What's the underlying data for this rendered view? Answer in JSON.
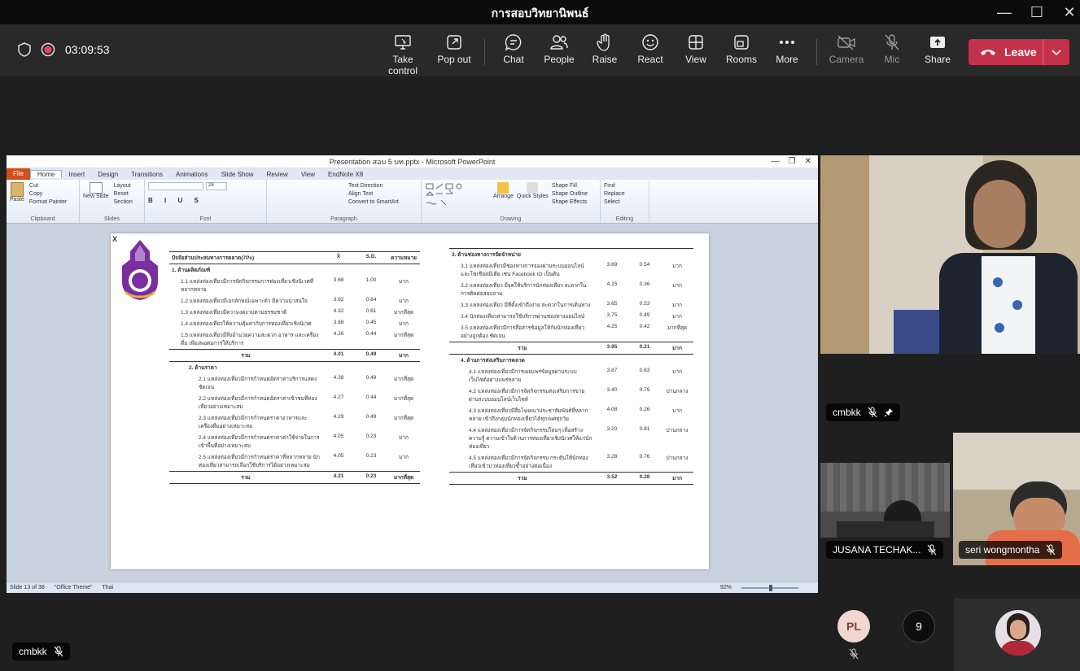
{
  "window": {
    "title": "การสอบวิทยานิพนธ์",
    "controls": [
      "minimize",
      "maximize",
      "close"
    ]
  },
  "toolbar": {
    "timer": "03:09:53",
    "buttons": [
      {
        "label": "Take control",
        "icon": "take-control-icon"
      },
      {
        "label": "Pop out",
        "icon": "pop-out-icon"
      },
      {
        "label": "Chat",
        "icon": "chat-icon"
      },
      {
        "label": "People",
        "icon": "people-icon"
      },
      {
        "label": "Raise",
        "icon": "raise-hand-icon"
      },
      {
        "label": "React",
        "icon": "react-icon"
      },
      {
        "label": "View",
        "icon": "view-icon"
      },
      {
        "label": "Rooms",
        "icon": "rooms-icon"
      },
      {
        "label": "More",
        "icon": "more-icon"
      },
      {
        "label": "Camera",
        "icon": "camera-off-icon"
      },
      {
        "label": "Mic",
        "icon": "mic-off-icon"
      },
      {
        "label": "Share",
        "icon": "share-icon"
      }
    ],
    "leave_label": "Leave",
    "leave_color": "#c4314b"
  },
  "powerpoint": {
    "title": "Presentation สอบ 5 บท.pptx - Microsoft PowerPoint",
    "tabs": [
      "File",
      "Home",
      "Insert",
      "Design",
      "Transitions",
      "Animations",
      "Slide Show",
      "Review",
      "View",
      "EndNote X8"
    ],
    "ribbon": {
      "clipboard": {
        "name": "Clipboard",
        "paste": "Paste",
        "cut": "Cut",
        "copy": "Copy",
        "format_painter": "Format Painter"
      },
      "slides": {
        "name": "Slides",
        "new_slide": "New Slide",
        "layout": "Layout",
        "reset": "Reset",
        "section": "Section"
      },
      "font": {
        "name": "Font",
        "size": "28"
      },
      "paragraph": {
        "name": "Paragraph",
        "text_direction": "Text Direction",
        "align_text": "Align Text",
        "smartart": "Convert to SmartArt"
      },
      "drawing": {
        "name": "Drawing",
        "arrange": "Arrange",
        "quick_styles": "Quick Styles",
        "shape_fill": "Shape Fill",
        "shape_outline": "Shape Outline",
        "shape_effects": "Shape Effects"
      },
      "editing": {
        "name": "Editing",
        "find": "Find",
        "replace": "Replace",
        "select": "Select"
      }
    },
    "status": {
      "slide": "Slide 13 of 38",
      "theme": "\"Office Theme\"",
      "lang": "Thai",
      "zoom": "92%"
    }
  },
  "slide": {
    "close_mark": "X",
    "left_header": {
      "title": "ปัจจัยส่วนประสมทางการตลาด(7Ps)",
      "mean": "X̄",
      "sd": "S.D.",
      "meaning": "ความหมาย"
    },
    "product": {
      "section": "1. ด้านผลิตภัณฑ์",
      "rows": [
        {
          "text": "1.1 แหล่งท่องเที่ยวมีการจัดกิจกรรมการท่องเที่ยวเชิงนิเวศที่หลากหลาย",
          "mean": "3.68",
          "sd": "1.00",
          "level": "มาก"
        },
        {
          "text": "1.2 แหล่งท่องเที่ยวมีเอกลักษณ์เฉพาะตัว มีความน่าสนใจ",
          "mean": "3.92",
          "sd": "0.64",
          "level": "มาก"
        },
        {
          "text": "1.3 แหล่งท่องเที่ยวมีความงดงามตามธรรมชาติ",
          "mean": "4.32",
          "sd": "0.61",
          "level": "มากที่สุด"
        },
        {
          "text": "1.4 แหล่งท่องเที่ยวให้ความคุ้มค่ากับการท่องเที่ยวเชิงนิเวศ",
          "mean": "3.88",
          "sd": "0.45",
          "level": "มาก"
        },
        {
          "text": "1.5 แหล่งท่องเที่ยวมีสิ่งอำนวยความสะดวก อาหาร และเครื่องดื่ม เพียงพอต่อการให้บริการ",
          "mean": "4.26",
          "sd": "0.44",
          "level": "มากที่สุด"
        }
      ],
      "total": {
        "label": "รวม",
        "mean": "4.01",
        "sd": "0.49",
        "level": "มาก"
      }
    },
    "price": {
      "section": "2. ด้านราคา",
      "rows": [
        {
          "text": "2.1 แหล่งท่องเที่ยวมีการกำหนดอัตราค่าบริการแสดงชัดเจน",
          "mean": "4.38",
          "sd": "0.49",
          "level": "มากที่สุด"
        },
        {
          "text": "2.2 แหล่งท่องเที่ยวมีการกำหนดอัตราค่าเข้าชมที่ท่องเที่ยวอย่างเหมาะสม",
          "mean": "4.27",
          "sd": "0.44",
          "level": "มากที่สุด"
        },
        {
          "text": "2.3 แหล่งท่องเที่ยวมีการกำหนดราคาอาหารและเครื่องดื่มอย่างเหมาะสม",
          "mean": "4.29",
          "sd": "0.49",
          "level": "มากที่สุด"
        },
        {
          "text": "2.4 แหล่งท่องเที่ยวมีการกำหนดราคาค่าใช้จ่ายในการเข้าพื้นที่อย่างเหมาะสม",
          "mean": "4.05",
          "sd": "0.23",
          "level": "มาก"
        },
        {
          "text": "2.5 แหล่งท่องเที่ยวมีการกำหนดราคาที่หลากหลาย นักท่องเที่ยวสามารถเลือกใช้บริการได้อย่างเหมาะสม",
          "mean": "4.05",
          "sd": "0.23",
          "level": "มาก"
        }
      ],
      "total": {
        "label": "รวม",
        "mean": "4.21",
        "sd": "0.23",
        "level": "มากที่สุด"
      }
    },
    "place": {
      "section": "3. ด้านช่องทางการจัดจำหน่าย",
      "rows": [
        {
          "text": "3.1 แหล่งท่องเที่ยวมีช่องทางการจองผ่านระบบออนไลน์ และโซเชียลมีเดีย เช่น Facebook IG เป็นต้น",
          "mean": "3.69",
          "sd": "0.54",
          "level": "มาก"
        },
        {
          "text": "3.2 แหล่งท่องเที่ยว มีจุดให้บริการนักท่องเที่ยว สะดวกในการติดต่อสอบถาม",
          "mean": "4.15",
          "sd": "0.36",
          "level": "มาก"
        },
        {
          "text": "3.3 แหล่งท่องเที่ยว มีที่ตั้งเข้าถึงง่าย สะดวกในการเดินทาง",
          "mean": "3.65",
          "sd": "0.53",
          "level": "มาก"
        },
        {
          "text": "3.4 นักท่องเที่ยวสามารถใช้บริการผ่านช่องทางออนไลน์",
          "mean": "3.75",
          "sd": "0.49",
          "level": "มาก"
        },
        {
          "text": "3.5 แหล่งท่องเที่ยวมีการสื่อสารข้อมูลให้กับนักท่องเที่ยวอย่างถูกต้อง ชัดเจน",
          "mean": "4.25",
          "sd": "0.42",
          "level": "มากที่สุด"
        }
      ],
      "total": {
        "label": "รวม",
        "mean": "3.95",
        "sd": "0.21",
        "level": "มาก"
      }
    },
    "promotion": {
      "section": "4. ด้านการส่งเสริมการตลาด",
      "rows": [
        {
          "text": "4.1 แหล่งท่องเที่ยวมีการเผยแพร่ข้อมูลผ่านระบบเว็บไซต์อย่างแพร่หลาย",
          "mean": "3.87",
          "sd": "0.63",
          "level": "มาก"
        },
        {
          "text": "4.2 แหล่งท่องเที่ยวมีการจัดกิจกรรมส่งเสริมการขายผ่านระบบออนไลน์เว็บไซต์",
          "mean": "3.40",
          "sd": "0.79",
          "level": "ปานกลาง"
        },
        {
          "text": "4.3 แหล่งท่องเที่ยวมีสื่อโฆษณาประชาสัมพันธ์ที่หลากหลาย เข้าถึงกลุ่มนักท่องเที่ยวได้ทุกเพศทุกวัย",
          "mean": "4.08",
          "sd": "0.26",
          "level": "มาก"
        },
        {
          "text": "4.4 แหล่งท่องเที่ยวมีการจัดกิจกรรมใหม่ๆ เพื่อสร้างความรู้ ความเข้าใจด้านการท่องเที่ยวเชิงนิเวศให้แก่นักท่องเที่ยว",
          "mean": "3.20",
          "sd": "0.81",
          "level": "ปานกลาง"
        },
        {
          "text": "4.5 แหล่งท่องเที่ยวมีการจัดกิจกรรม กระตุ้นให้นักท่องเที่ยวเข้ามาท่องเที่ยวซ้ำอย่างต่อเนื่อง",
          "mean": "3.28",
          "sd": "0.76",
          "level": "ปานกลาง"
        }
      ],
      "total": {
        "label": "รวม",
        "mean": "3.52",
        "sd": "0.28",
        "level": "มาก"
      }
    }
  },
  "participants": {
    "presenter_tag": "cmbkk",
    "main_tile": {
      "name": "cmbkk"
    },
    "tile2": {
      "name": "JUSANA TECHAK..."
    },
    "tile3": {
      "name": "seri wongmontha"
    },
    "avatar_initials": "PL",
    "avatar_color": "#f2d7d0",
    "overflow_count": "9"
  }
}
